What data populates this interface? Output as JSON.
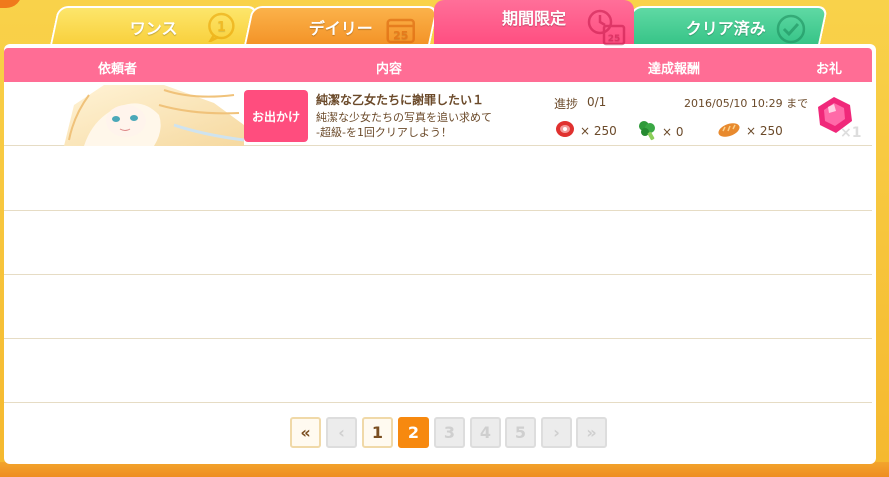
{
  "tabs": {
    "once": "ワンス",
    "daily": "デイリー",
    "limited": "期間限定",
    "cleared": "クリア済み",
    "once_icon_text": "1",
    "daily_icon_text": "25",
    "limited_icon_text": "25"
  },
  "header": {
    "client": "依頼者",
    "content": "内容",
    "reward": "達成報酬",
    "gift": "お礼"
  },
  "missions": [
    {
      "category": "お出かけ",
      "title": "純潔な乙女たちに謝罪したい１",
      "desc_line1": "純潔な少女たちの写真を追い求めて",
      "desc_line2": "-超級-を1回クリアしよう！",
      "progress_label": "進捗",
      "progress": "0/1",
      "deadline": "2016/05/10 10:29 まで",
      "rewards": [
        {
          "icon": "meat-icon",
          "text": "× 250"
        },
        {
          "icon": "vegetable-icon",
          "text": "× 0"
        },
        {
          "icon": "bread-icon",
          "text": "× 250"
        }
      ],
      "gift_icon": "gem-icon",
      "gift_count": "×1"
    }
  ],
  "pager": {
    "first": "«",
    "prev": "‹",
    "pages": [
      "1",
      "2",
      "3",
      "4",
      "5"
    ],
    "current": "2",
    "next": "›",
    "last": "»"
  },
  "colors": {
    "header": "#ff6d95",
    "limited_tab": "#ff4d80",
    "current_page": "#f7890f",
    "frame": "#f7c53a"
  }
}
